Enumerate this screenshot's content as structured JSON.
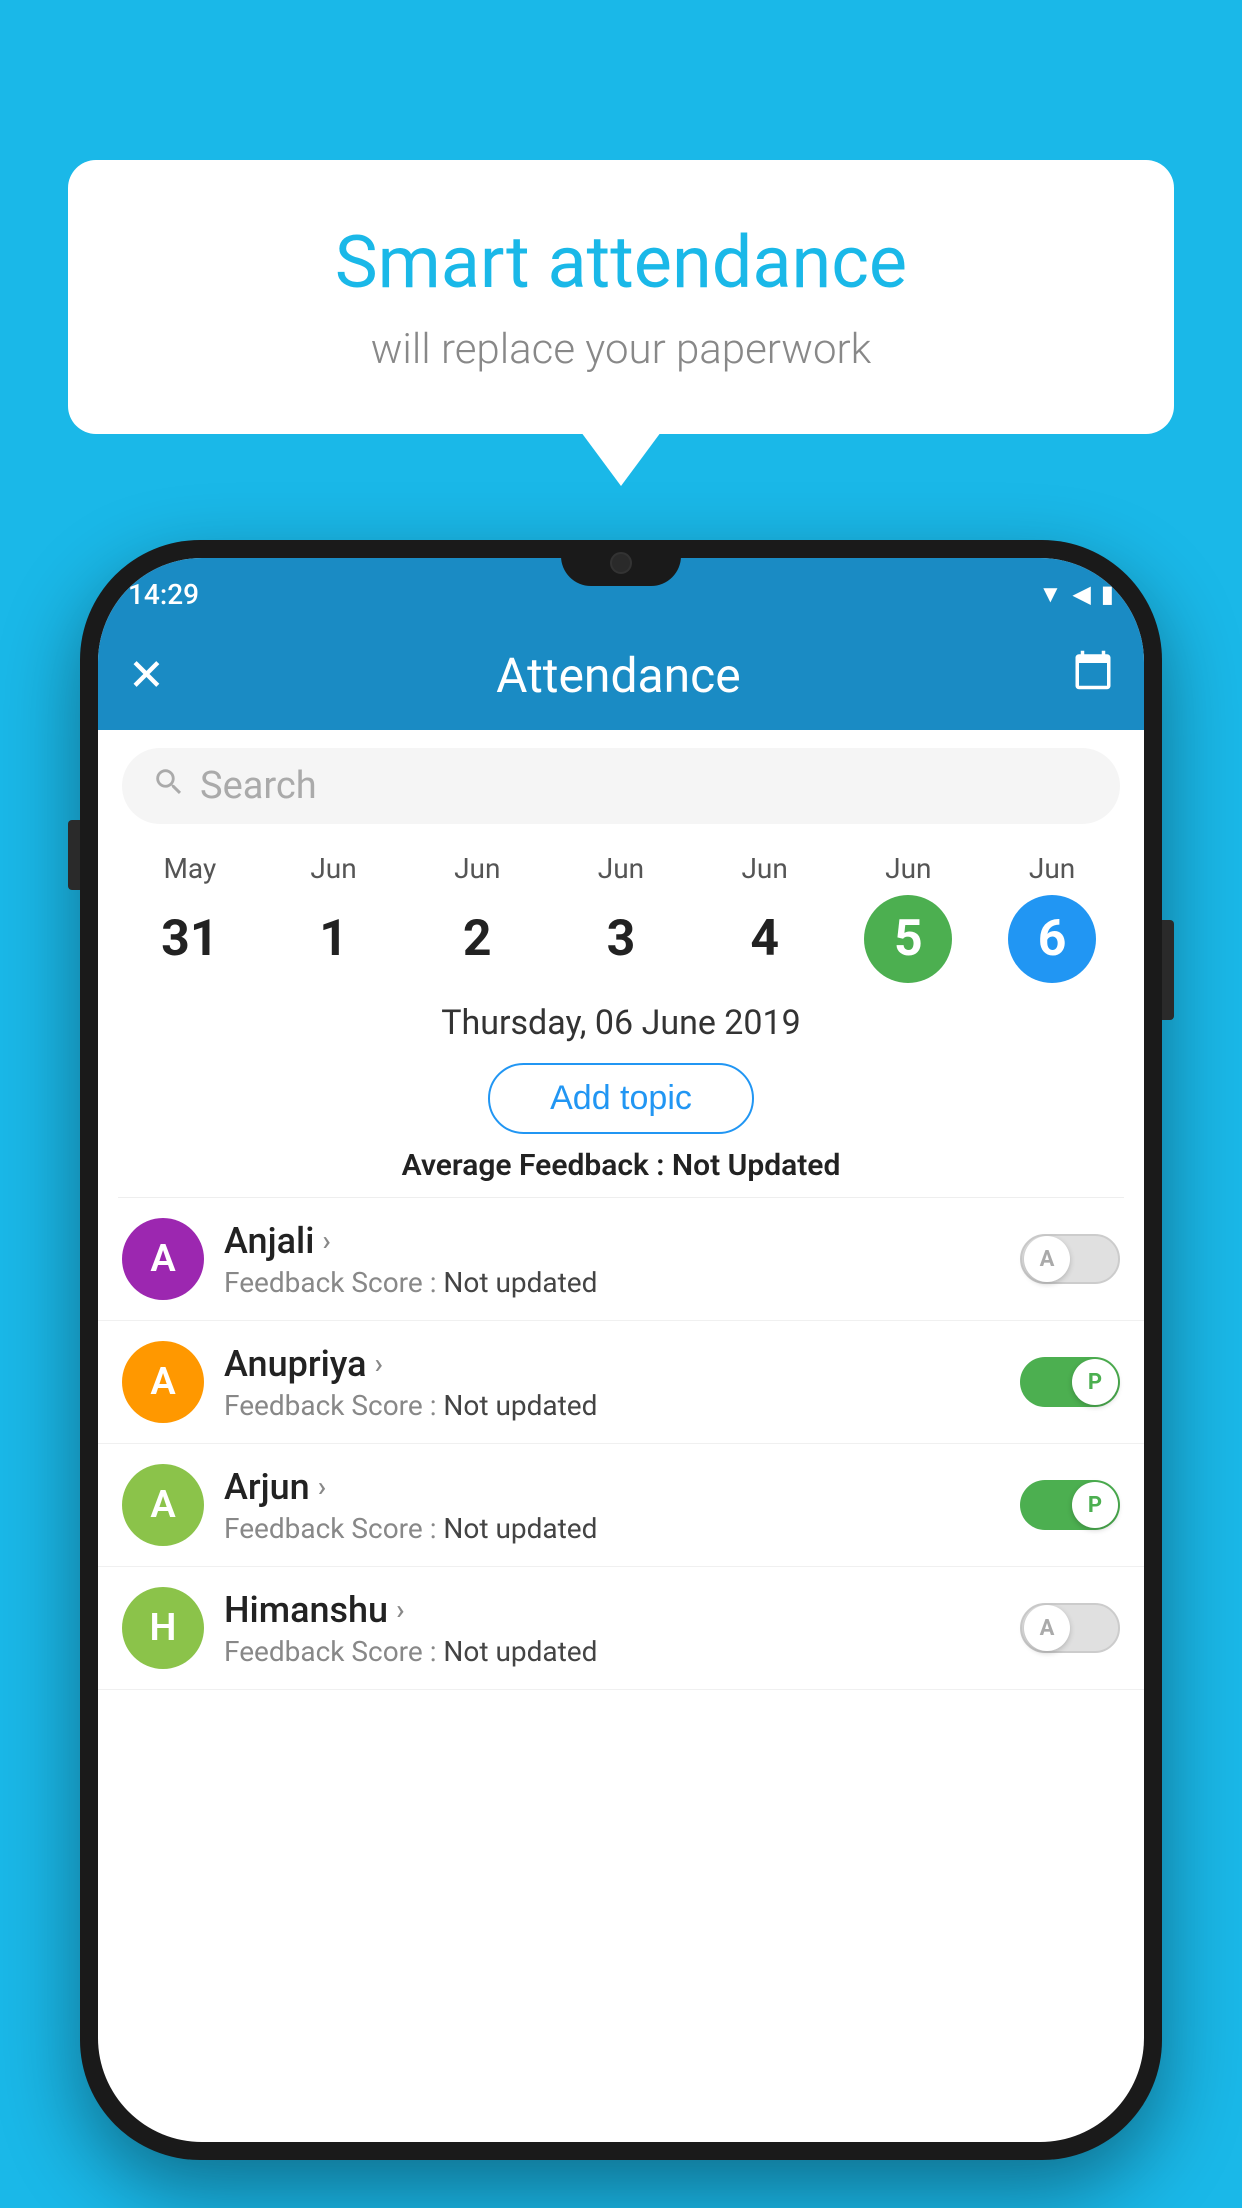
{
  "background_color": "#1ab8e8",
  "speech_bubble": {
    "title": "Smart attendance",
    "subtitle": "will replace your paperwork"
  },
  "phone": {
    "status_bar": {
      "time": "14:29"
    },
    "app_bar": {
      "title": "Attendance",
      "close_label": "✕",
      "calendar_icon": "calendar"
    },
    "search": {
      "placeholder": "Search"
    },
    "calendar": {
      "days": [
        {
          "month": "May",
          "date": "31",
          "state": "normal"
        },
        {
          "month": "Jun",
          "date": "1",
          "state": "normal"
        },
        {
          "month": "Jun",
          "date": "2",
          "state": "normal"
        },
        {
          "month": "Jun",
          "date": "3",
          "state": "normal"
        },
        {
          "month": "Jun",
          "date": "4",
          "state": "normal"
        },
        {
          "month": "Jun",
          "date": "5",
          "state": "today"
        },
        {
          "month": "Jun",
          "date": "6",
          "state": "selected"
        }
      ]
    },
    "selected_date": "Thursday, 06 June 2019",
    "add_topic_label": "Add topic",
    "avg_feedback_label": "Average Feedback :",
    "avg_feedback_value": "Not Updated",
    "students": [
      {
        "name": "Anjali",
        "avatar_letter": "A",
        "avatar_color": "#9c27b0",
        "feedback_label": "Feedback Score :",
        "feedback_value": "Not updated",
        "toggle_state": "off",
        "toggle_letter": "A"
      },
      {
        "name": "Anupriya",
        "avatar_letter": "A",
        "avatar_color": "#ff9800",
        "feedback_label": "Feedback Score :",
        "feedback_value": "Not updated",
        "toggle_state": "on",
        "toggle_letter": "P"
      },
      {
        "name": "Arjun",
        "avatar_letter": "A",
        "avatar_color": "#8bc34a",
        "feedback_label": "Feedback Score :",
        "feedback_value": "Not updated",
        "toggle_state": "on",
        "toggle_letter": "P"
      },
      {
        "name": "Himanshu",
        "avatar_letter": "H",
        "avatar_color": "#8bc34a",
        "feedback_label": "Feedback Score :",
        "feedback_value": "Not updated",
        "toggle_state": "off",
        "toggle_letter": "A"
      }
    ]
  }
}
